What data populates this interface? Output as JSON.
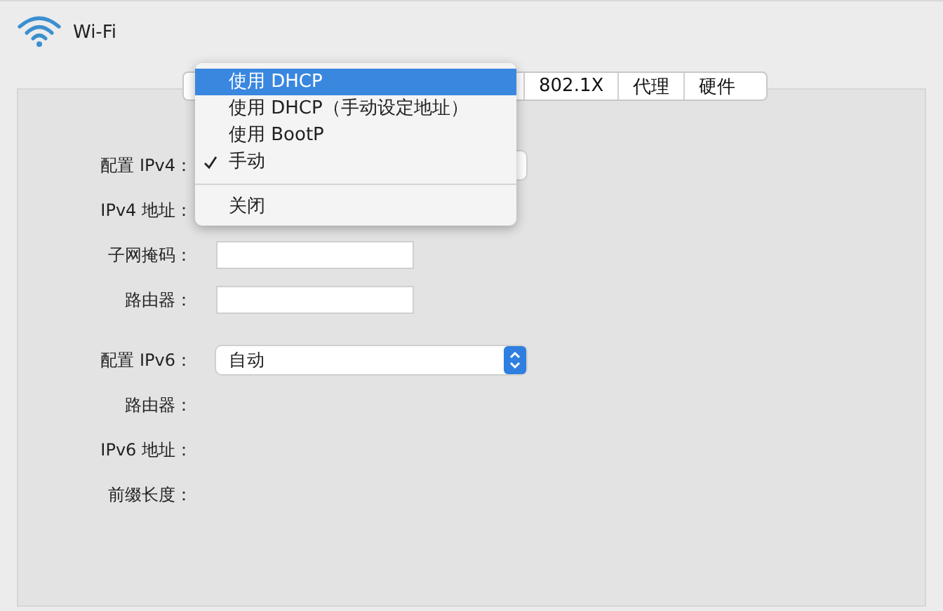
{
  "header": {
    "title": "Wi-Fi"
  },
  "tabs": [
    {
      "label": "802.1X",
      "selected": false
    },
    {
      "label": "代理",
      "selected": false
    },
    {
      "label": "硬件",
      "selected": false
    }
  ],
  "sections": [
    {
      "rows": [
        {
          "label": "配置 IPv4：",
          "kind": "popup"
        },
        {
          "label": "IPv4 地址：",
          "kind": "blank"
        },
        {
          "label": "子网掩码：",
          "kind": "field"
        },
        {
          "label": "路由器：",
          "kind": "field"
        }
      ]
    },
    {
      "rows": [
        {
          "label": "配置 IPv6：",
          "kind": "popup",
          "value": "自动"
        },
        {
          "label": "路由器：",
          "kind": "blank"
        },
        {
          "label": "IPv6 地址：",
          "kind": "blank"
        },
        {
          "label": "前缀长度：",
          "kind": "blank"
        }
      ]
    }
  ],
  "menu": {
    "items": [
      {
        "kind": "option",
        "label": "使用 DHCP",
        "highlighted": true,
        "checked": false
      },
      {
        "kind": "option",
        "label": "使用 DHCP（手动设定地址）",
        "highlighted": false,
        "checked": false
      },
      {
        "kind": "option",
        "label": "使用 BootP",
        "highlighted": false,
        "checked": false
      },
      {
        "kind": "option",
        "label": "手动",
        "highlighted": false,
        "checked": true
      },
      {
        "kind": "separator"
      },
      {
        "kind": "option",
        "label": "关闭",
        "highlighted": false,
        "checked": false
      }
    ]
  }
}
